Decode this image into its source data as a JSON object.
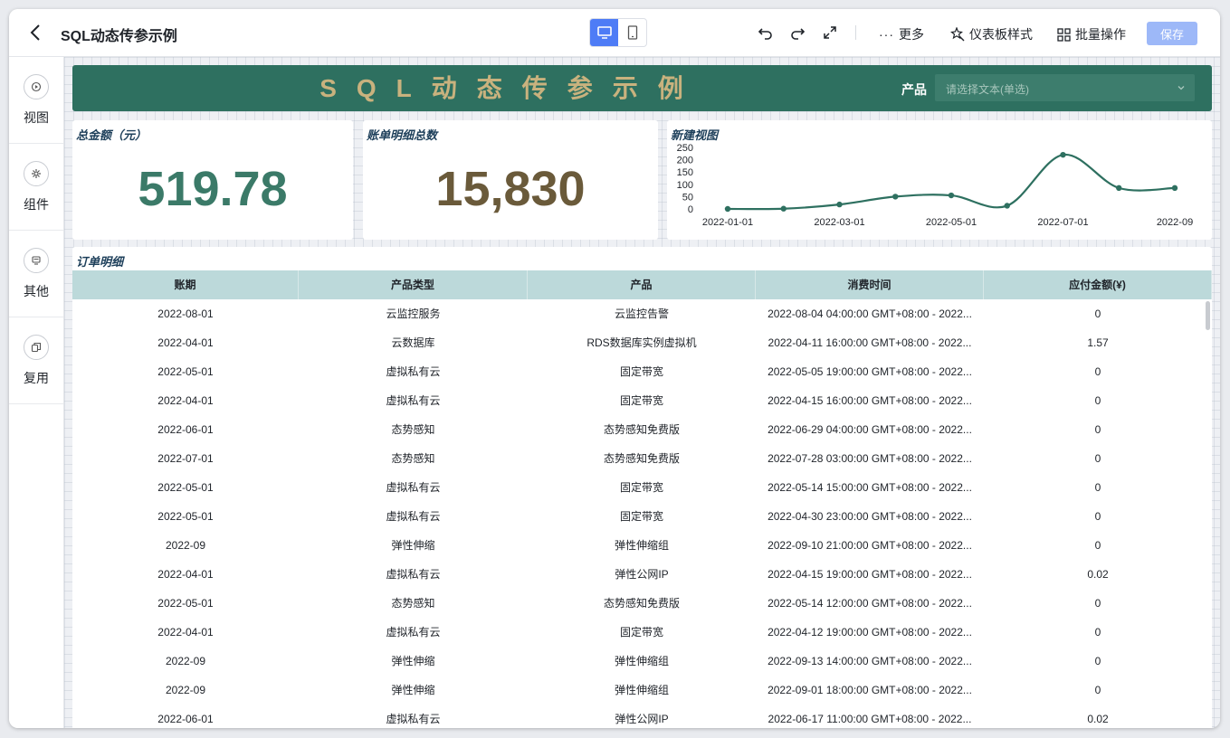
{
  "header": {
    "title": "SQL动态传参示例",
    "more_label": "更多",
    "style_label": "仪表板样式",
    "batch_label": "批量操作",
    "save_label": "保存"
  },
  "sidebar": {
    "items": [
      {
        "label": "视图",
        "icon": "view-icon"
      },
      {
        "label": "组件",
        "icon": "component-icon"
      },
      {
        "label": "其他",
        "icon": "other-icon"
      },
      {
        "label": "复用",
        "icon": "reuse-icon"
      }
    ]
  },
  "banner": {
    "title": "SQL动态传参示例",
    "filter_label": "产品",
    "filter_placeholder": "请选择文本(单选)"
  },
  "kpis": {
    "total_amount": {
      "title": "总金额（元）",
      "value": "519.78",
      "color": "#3b7a68"
    },
    "bill_count": {
      "title": "账单明细总数",
      "value": "15,830",
      "color": "#6a5a3a"
    }
  },
  "chart_data": {
    "type": "line",
    "title": "新建视图",
    "x": [
      "2022-01-01",
      "2022-02-01",
      "2022-03-01",
      "2022-04-01",
      "2022-05-01",
      "2022-06-01",
      "2022-07-01",
      "2022-08-01",
      "2022-09"
    ],
    "x_tick_labels": [
      "2022-01-01",
      "2022-03-01",
      "2022-05-01",
      "2022-07-01",
      "2022-09"
    ],
    "values": [
      0,
      1,
      18,
      50,
      55,
      13,
      220,
      85,
      85
    ],
    "ylim": [
      0,
      250
    ],
    "y_ticks": [
      0,
      50,
      100,
      150,
      200,
      250
    ],
    "color": "#2e7060",
    "grid": false
  },
  "table": {
    "title": "订单明细",
    "columns": [
      "账期",
      "产品类型",
      "产品",
      "消费时间",
      "应付金额(¥)"
    ],
    "rows": [
      [
        "2022-08-01",
        "云监控服务",
        "云监控告警",
        "2022-08-04 04:00:00 GMT+08:00 - 2022...",
        "0"
      ],
      [
        "2022-04-01",
        "云数据库",
        "RDS数据库实例虚拟机",
        "2022-04-11 16:00:00 GMT+08:00 - 2022...",
        "1.57"
      ],
      [
        "2022-05-01",
        "虚拟私有云",
        "固定带宽",
        "2022-05-05 19:00:00 GMT+08:00 - 2022...",
        "0"
      ],
      [
        "2022-04-01",
        "虚拟私有云",
        "固定带宽",
        "2022-04-15 16:00:00 GMT+08:00 - 2022...",
        "0"
      ],
      [
        "2022-06-01",
        "态势感知",
        "态势感知免费版",
        "2022-06-29 04:00:00 GMT+08:00 - 2022...",
        "0"
      ],
      [
        "2022-07-01",
        "态势感知",
        "态势感知免费版",
        "2022-07-28 03:00:00 GMT+08:00 - 2022...",
        "0"
      ],
      [
        "2022-05-01",
        "虚拟私有云",
        "固定带宽",
        "2022-05-14 15:00:00 GMT+08:00 - 2022...",
        "0"
      ],
      [
        "2022-05-01",
        "虚拟私有云",
        "固定带宽",
        "2022-04-30 23:00:00 GMT+08:00 - 2022...",
        "0"
      ],
      [
        "2022-09",
        "弹性伸缩",
        "弹性伸缩组",
        "2022-09-10 21:00:00 GMT+08:00 - 2022...",
        "0"
      ],
      [
        "2022-04-01",
        "虚拟私有云",
        "弹性公网IP",
        "2022-04-15 19:00:00 GMT+08:00 - 2022...",
        "0.02"
      ],
      [
        "2022-05-01",
        "态势感知",
        "态势感知免费版",
        "2022-05-14 12:00:00 GMT+08:00 - 2022...",
        "0"
      ],
      [
        "2022-04-01",
        "虚拟私有云",
        "固定带宽",
        "2022-04-12 19:00:00 GMT+08:00 - 2022...",
        "0"
      ],
      [
        "2022-09",
        "弹性伸缩",
        "弹性伸缩组",
        "2022-09-13 14:00:00 GMT+08:00 - 2022...",
        "0"
      ],
      [
        "2022-09",
        "弹性伸缩",
        "弹性伸缩组",
        "2022-09-01 18:00:00 GMT+08:00 - 2022...",
        "0"
      ],
      [
        "2022-06-01",
        "虚拟私有云",
        "弹性公网IP",
        "2022-06-17 11:00:00 GMT+08:00 - 2022...",
        "0.02"
      ]
    ]
  }
}
